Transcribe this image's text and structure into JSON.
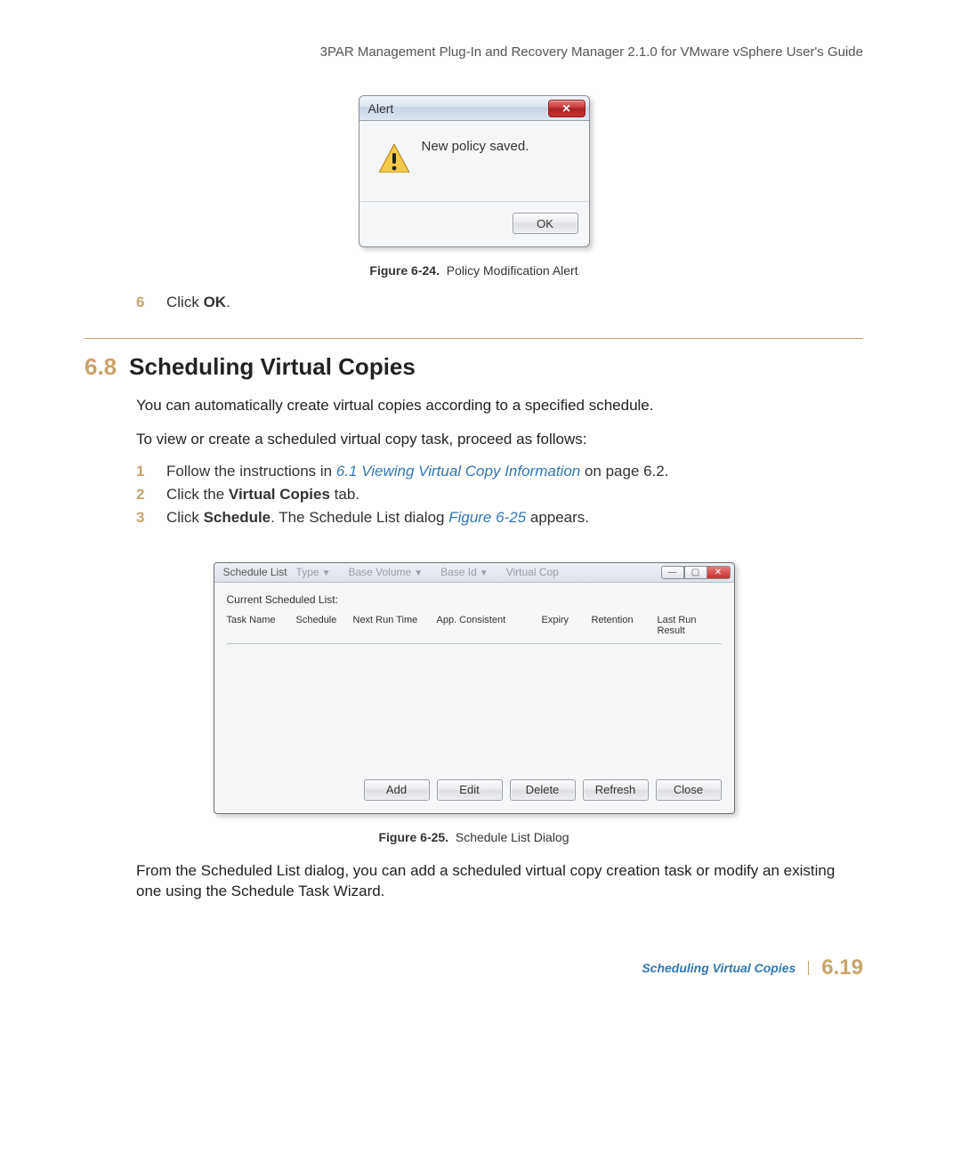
{
  "header": {
    "running_title": "3PAR Management Plug-In and Recovery Manager 2.1.0 for VMware vSphere User's Guide"
  },
  "alert": {
    "title": "Alert",
    "message": "New policy saved.",
    "ok_label": "OK",
    "close_glyph": "✕"
  },
  "figure1": {
    "label": "Figure 6-24.",
    "caption": "Policy Modification Alert"
  },
  "step_top": {
    "num": "6",
    "text_a": "Click ",
    "bold": "OK",
    "text_b": "."
  },
  "section": {
    "number": "6.8",
    "title": "Scheduling Virtual Copies",
    "para1": "You can automatically create virtual copies according to a specified schedule.",
    "para2": "To view or create a scheduled virtual copy task, proceed as follows:"
  },
  "steps": {
    "s1": {
      "num": "1",
      "a": "Follow the instructions in ",
      "link": "6.1 Viewing Virtual Copy Information",
      "b": " on page 6.2."
    },
    "s2": {
      "num": "2",
      "a": "Click the ",
      "bold": "Virtual Copies",
      "b": " tab."
    },
    "s3": {
      "num": "3",
      "a": "Click ",
      "bold": "Schedule",
      "b": ". The Schedule List dialog ",
      "link": "Figure 6-25",
      "c": " appears."
    }
  },
  "schedwin": {
    "title": "Schedule List",
    "t_extra": {
      "type": "Type",
      "basevol": "Base Volume",
      "baseid": "Base Id",
      "vc": "Virtual Cop"
    },
    "body_label": "Current Scheduled List:",
    "cols": {
      "c1": "Task Name",
      "c2": "Schedule",
      "c3": "Next Run Time",
      "c4": "App. Consistent",
      "c5": "Expiry",
      "c6": "Retention",
      "c7": "Last Run Result"
    },
    "buttons": {
      "add": "Add",
      "edit": "Edit",
      "del": "Delete",
      "refresh": "Refresh",
      "close": "Close"
    }
  },
  "figure2": {
    "label": "Figure 6-25.",
    "caption": "Schedule List Dialog"
  },
  "para3": "From the Scheduled List dialog, you can add a scheduled virtual copy creation task or modify an existing one using the Schedule Task Wizard.",
  "footer": {
    "link": "Scheduling Virtual Copies",
    "page": "6.19"
  }
}
